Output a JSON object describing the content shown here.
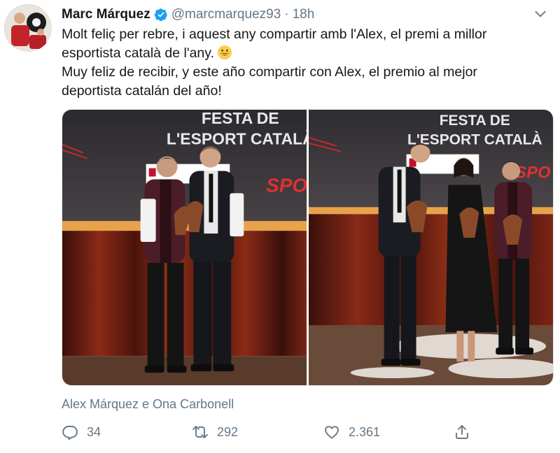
{
  "tweet": {
    "author_name": "Marc Márquez",
    "handle": "@marcmarquez93",
    "separator": "·",
    "time": "18h",
    "verified": true,
    "text_lines": [
      "Molt feliç per rebre, i aquest any compartir amb l'Alex, el premi a millor",
      "esportista català de l'any.",
      "Muy feliz de recibir, y este año compartir con Alex, el premio al mejor",
      "deportista catalán del año!"
    ],
    "emoji": "grinning-face",
    "photos": [
      {
        "backdrop_line1": "FESTA DE",
        "backdrop_line2": "L'ESPORT CATALÀ",
        "backdrop_side": "SPO"
      },
      {
        "backdrop_line1": "FESTA DE",
        "backdrop_line2": "L'ESPORT CATALÀ",
        "backdrop_side": "SPO"
      }
    ],
    "tagged_people": "Alex Márquez e Ona Carbonell",
    "metrics": {
      "replies": "34",
      "retweets": "292",
      "likes": "2.361"
    }
  },
  "colors": {
    "text_primary": "#14171a",
    "text_secondary": "#657786",
    "verified_blue": "#1da1f2",
    "stage_red": "#7a1c12"
  },
  "icons": {
    "reply": "reply-icon",
    "retweet": "retweet-icon",
    "like": "heart-icon",
    "share": "share-icon",
    "menu": "chevron-down-icon",
    "verified": "verified-badge-icon"
  }
}
